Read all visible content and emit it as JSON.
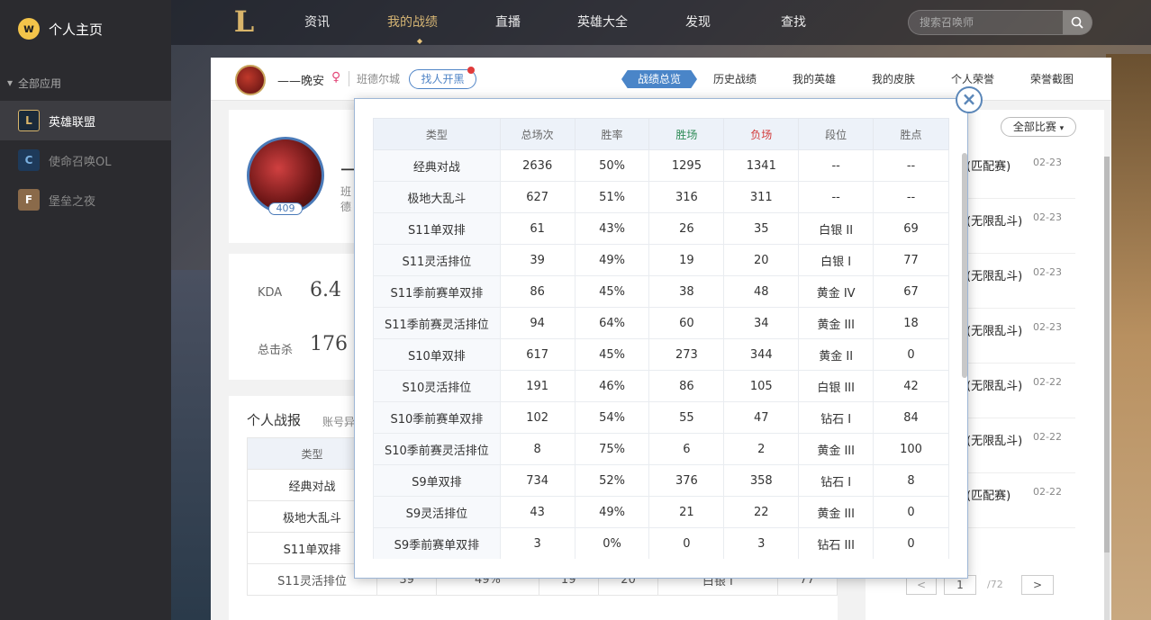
{
  "app": {
    "title": "个人主页",
    "logo_glyph": "w"
  },
  "sidebar": {
    "group_label": "全部应用",
    "items": [
      {
        "label": "英雄联盟",
        "glyph": "L",
        "active": true
      },
      {
        "label": "使命召唤OL",
        "glyph": "C"
      },
      {
        "label": "堡垒之夜",
        "glyph": "F"
      }
    ]
  },
  "topnav": {
    "logo_glyph": "L",
    "items": [
      "资讯",
      "我的战绩",
      "直播",
      "英雄大全",
      "发现",
      "查找"
    ],
    "active": "我的战绩",
    "search_placeholder": "搜索召唤师"
  },
  "subbar": {
    "username": "——晚安",
    "gender": "♀",
    "server": "班德尔城",
    "find_button": "找人开黑",
    "tabs": [
      "战绩总览",
      "历史战绩",
      "我的英雄",
      "我的皮肤",
      "个人荣誉",
      "荣誉截图"
    ],
    "active_tab": "战绩总览"
  },
  "profile": {
    "level": "409",
    "name_fragment": "一",
    "server_fragment": "班德"
  },
  "stats": {
    "kda_label": "KDA",
    "kda_value": "6.4",
    "kills_label": "总击杀",
    "kills_value": "176"
  },
  "report": {
    "title": "个人战报",
    "subtitle": "账号异",
    "header": "类型",
    "rows": [
      {
        "type": "经典对战"
      },
      {
        "type": "极地大乱斗"
      },
      {
        "type": "S11单双排"
      },
      {
        "type": "S11灵活排位",
        "cells": [
          "39",
          "49%",
          "19",
          "20",
          "白银 I",
          "77"
        ]
      }
    ]
  },
  "right": {
    "filter": "全部比赛",
    "matches": [
      {
        "title": "(匹配赛)",
        "date": "02-23"
      },
      {
        "title": "(无限乱斗)",
        "date": "02-23"
      },
      {
        "title": "(无限乱斗)",
        "date": "02-23"
      },
      {
        "title": "(无限乱斗)",
        "date": "02-23"
      },
      {
        "title": "(无限乱斗)",
        "date": "02-22"
      },
      {
        "title": "(无限乱斗)",
        "date": "02-22"
      },
      {
        "title": "(匹配赛)",
        "date": "02-22"
      }
    ],
    "pager": {
      "prev": "<",
      "current": "1",
      "total": "/72",
      "next": ">"
    }
  },
  "modal": {
    "close_glyph": "×",
    "headers": [
      "类型",
      "总场次",
      "胜率",
      "胜场",
      "负场",
      "段位",
      "胜点"
    ],
    "header_colors": {
      "wins": "#2e8b57",
      "losses": "#d23b3b"
    },
    "rows": [
      [
        "经典对战",
        "2636",
        "50%",
        "1295",
        "1341",
        "--",
        "--"
      ],
      [
        "极地大乱斗",
        "627",
        "51%",
        "316",
        "311",
        "--",
        "--"
      ],
      [
        "S11单双排",
        "61",
        "43%",
        "26",
        "35",
        "白银 II",
        "69"
      ],
      [
        "S11灵活排位",
        "39",
        "49%",
        "19",
        "20",
        "白银 I",
        "77"
      ],
      [
        "S11季前赛单双排",
        "86",
        "45%",
        "38",
        "48",
        "黄金 IV",
        "67"
      ],
      [
        "S11季前赛灵活排位",
        "94",
        "64%",
        "60",
        "34",
        "黄金 III",
        "18"
      ],
      [
        "S10单双排",
        "617",
        "45%",
        "273",
        "344",
        "黄金 II",
        "0"
      ],
      [
        "S10灵活排位",
        "191",
        "46%",
        "86",
        "105",
        "白银 III",
        "42"
      ],
      [
        "S10季前赛单双排",
        "102",
        "54%",
        "55",
        "47",
        "钻石 I",
        "84"
      ],
      [
        "S10季前赛灵活排位",
        "8",
        "75%",
        "6",
        "2",
        "黄金 III",
        "100"
      ],
      [
        "S9单双排",
        "734",
        "52%",
        "376",
        "358",
        "钻石 I",
        "8"
      ],
      [
        "S9灵活排位",
        "43",
        "49%",
        "21",
        "22",
        "黄金 III",
        "0"
      ],
      [
        "S9季前赛单双排",
        "3",
        "0%",
        "0",
        "3",
        "钻石 III",
        "0"
      ]
    ]
  }
}
